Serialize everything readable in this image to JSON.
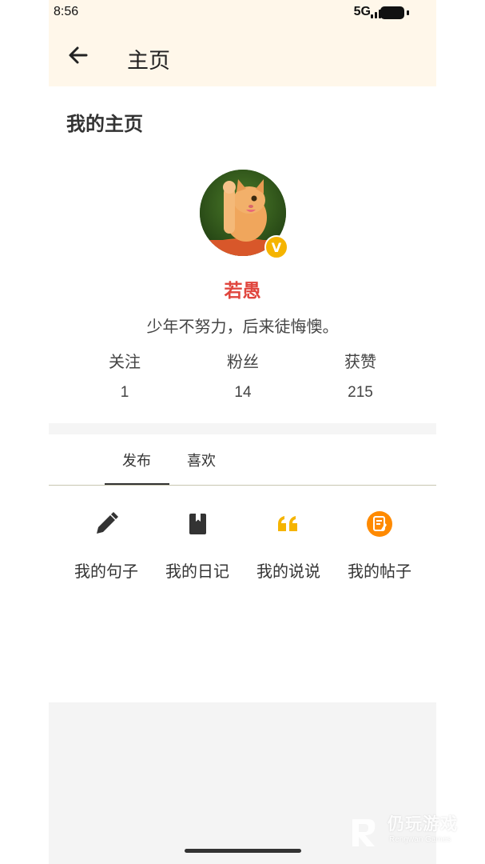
{
  "status_bar": {
    "time": "8:56",
    "network": "5G"
  },
  "app_bar": {
    "title": "主页"
  },
  "section": {
    "title": "我的主页"
  },
  "profile": {
    "badge": "V",
    "name": "若愚",
    "bio": "少年不努力，后来徒悔懊。"
  },
  "stats": [
    {
      "label": "关注",
      "value": "1"
    },
    {
      "label": "粉丝",
      "value": "14"
    },
    {
      "label": "获赞",
      "value": "215"
    }
  ],
  "tabs": [
    {
      "label": "发布",
      "selected": true
    },
    {
      "label": "喜欢",
      "selected": false
    }
  ],
  "actions": [
    {
      "label": "我的句子",
      "icon": "pencil-icon",
      "color": "#333333"
    },
    {
      "label": "我的日记",
      "icon": "book-icon",
      "color": "#333333"
    },
    {
      "label": "我的说说",
      "icon": "quote-icon",
      "color": "#f5b400"
    },
    {
      "label": "我的帖子",
      "icon": "post-icon",
      "color": "#ff8a00"
    }
  ],
  "watermark": {
    "text": "仍玩游戏",
    "sub": "Rengwan Games"
  },
  "colors": {
    "app_bar_bg": "#fff7ea",
    "name_red": "#e0463e",
    "badge_gold": "#f5b400"
  }
}
